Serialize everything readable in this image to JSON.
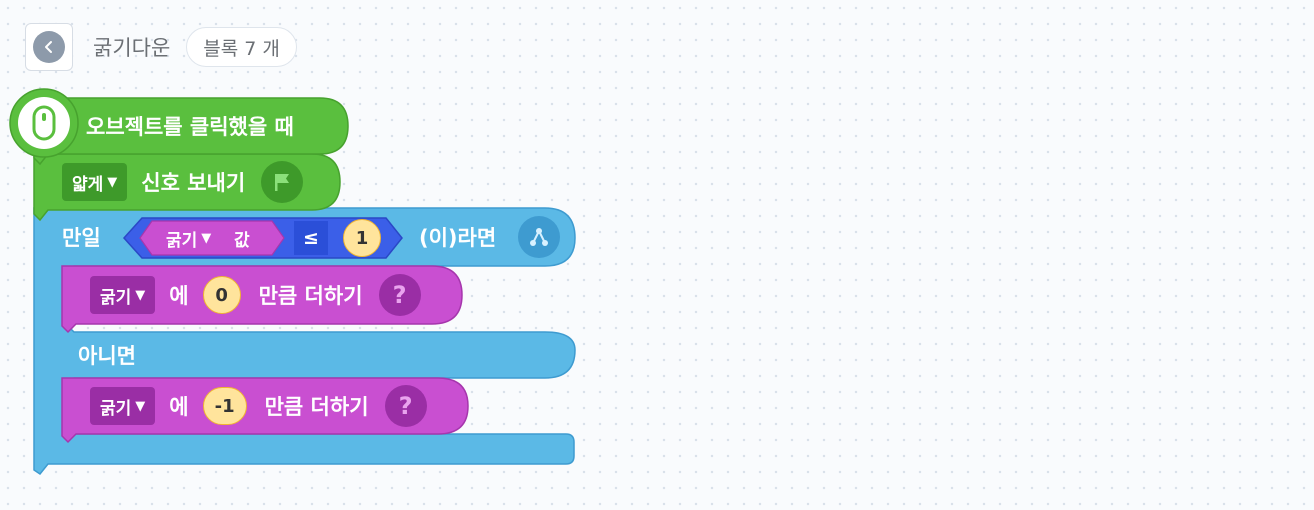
{
  "header": {
    "title": "굵기다운",
    "block_count": "블록 7 개"
  },
  "colors": {
    "start_green": "#5abf3e",
    "flow_blue": "#5bb9e6",
    "var_purple": "#c94fd1",
    "judge_blue": "#3b5fe8",
    "number_fill": "#ffe49c"
  },
  "blocks": {
    "hat": {
      "label": "오브젝트를 클릭했을 때",
      "icon": "mouse-icon"
    },
    "signal": {
      "dropdown": "얇게",
      "label": "신호 보내기",
      "icon": "flag-icon"
    },
    "if_else": {
      "if_label": "만일",
      "then_label": "(이)라면",
      "else_label": "아니면",
      "icon": "flow-icon",
      "condition": {
        "variable": "굵기",
        "value_label": "값",
        "operator": "≤",
        "number": "1"
      }
    },
    "add_then": {
      "dropdown": "굵기",
      "to_label": "에",
      "number": "0",
      "label": "만큼 더하기",
      "icon": "question-icon"
    },
    "add_else": {
      "dropdown": "굵기",
      "to_label": "에",
      "number": "-1",
      "label": "만큼 더하기",
      "icon": "question-icon"
    }
  }
}
